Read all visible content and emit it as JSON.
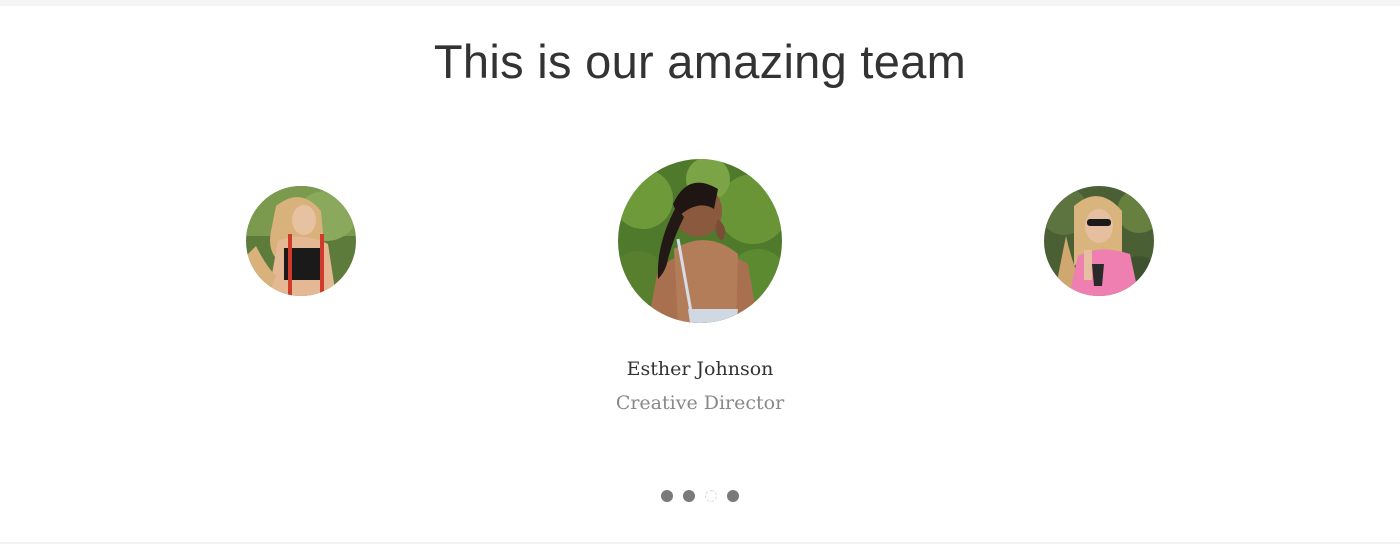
{
  "section": {
    "title": "This is our amazing team"
  },
  "team": {
    "members": [
      {
        "position": "left",
        "avatar_icon": "portrait-blonde-suspenders-icon"
      },
      {
        "position": "center",
        "name": "Esther Johnson",
        "role": "Creative Director",
        "avatar_icon": "portrait-dark-hair-back-icon"
      },
      {
        "position": "right",
        "avatar_icon": "portrait-blonde-sunglasses-icon"
      }
    ],
    "active_index": 1
  },
  "carousel": {
    "dots": [
      {
        "state": "inactive"
      },
      {
        "state": "inactive"
      },
      {
        "state": "active"
      },
      {
        "state": "inactive"
      }
    ]
  },
  "colors": {
    "title": "#333333",
    "name": "#333333",
    "role": "#888888",
    "dot": "#7a7a7a"
  }
}
